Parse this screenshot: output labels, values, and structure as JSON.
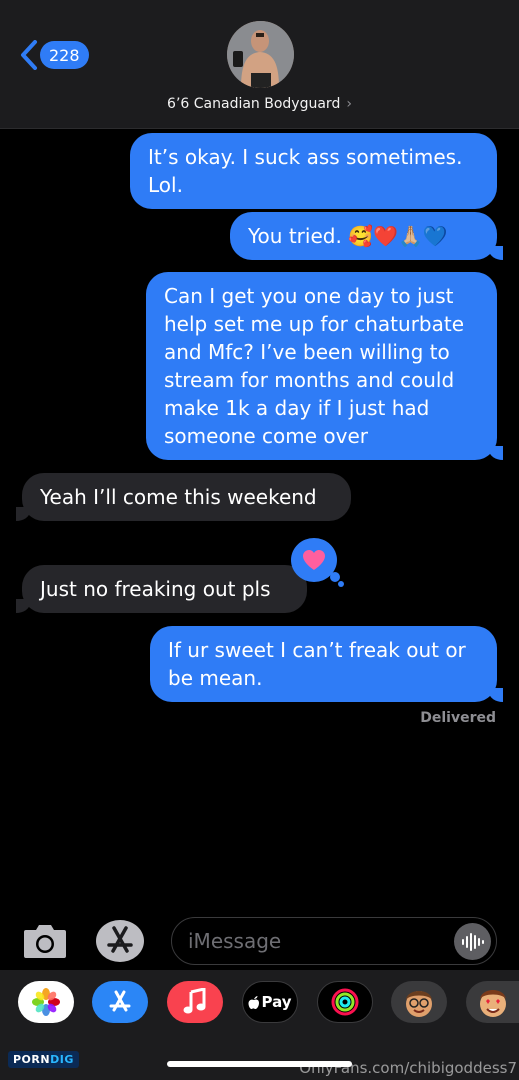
{
  "header": {
    "back_count": "228",
    "contact_name": "6’6 Canadian Bodyguard",
    "contact_chevron": "›"
  },
  "messages": [
    {
      "direction": "outgoing",
      "text": "It’s okay. I suck ass sometimes. Lol."
    },
    {
      "direction": "outgoing",
      "text": "You tried. 🥰❤️🙏🏼💙"
    },
    {
      "direction": "outgoing",
      "text": "Can I get you one day to just help set me up for chaturbate and Mfc? I’ve been willing to stream for months and could make 1k a day if I just had someone come over"
    },
    {
      "direction": "incoming",
      "text": "Yeah I’ll come this weekend"
    },
    {
      "direction": "incoming",
      "text": "Just no freaking out pls",
      "tapback": "heart"
    },
    {
      "direction": "outgoing",
      "text": "If ur sweet I can’t freak out or be mean."
    }
  ],
  "status": {
    "delivered": "Delivered"
  },
  "composer": {
    "placeholder": "iMessage"
  },
  "app_drawer": {
    "apps": [
      "photos-icon",
      "app-store-icon",
      "music-icon",
      "apple-pay-icon",
      "activity-icon",
      "memoji-icon",
      "memoji-icon"
    ],
    "apple_pay_label": "Pay"
  },
  "watermarks": {
    "left_part1": "PORN",
    "left_part2": "DIG",
    "right": "OnlyFans.com/chibigoddess7"
  },
  "colors": {
    "outgoing_bubble": "#2f7cf6",
    "incoming_bubble": "#26262a",
    "background": "#000000"
  }
}
